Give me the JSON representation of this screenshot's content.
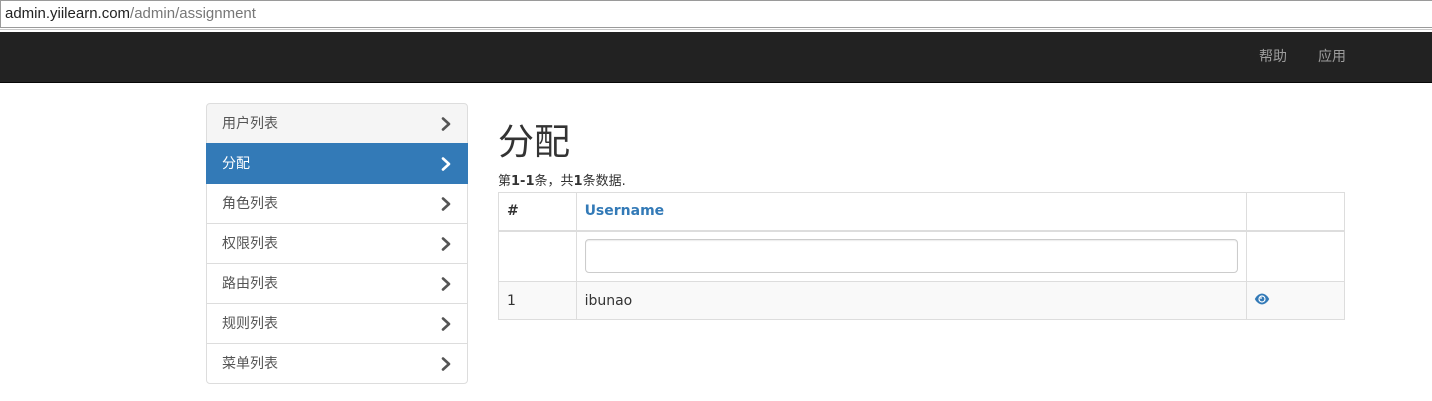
{
  "address_bar": {
    "host": "admin.yiilearn.com",
    "path": "/admin/assignment"
  },
  "navbar": {
    "items": [
      {
        "label": "帮助"
      },
      {
        "label": "应用"
      }
    ]
  },
  "sidebar": {
    "items": [
      {
        "label": "用户列表",
        "active": false
      },
      {
        "label": "分配",
        "active": true
      },
      {
        "label": "角色列表",
        "active": false
      },
      {
        "label": "权限列表",
        "active": false
      },
      {
        "label": "路由列表",
        "active": false
      },
      {
        "label": "规则列表",
        "active": false
      },
      {
        "label": "菜单列表",
        "active": false
      }
    ],
    "item_icon": "chevron-right-icon"
  },
  "main": {
    "title": "分配",
    "summary": {
      "prefix": "第",
      "range": "1-1",
      "middle": "条，共",
      "total": "1",
      "suffix": "条数据."
    },
    "table": {
      "headers": {
        "num": "#",
        "username": "Username",
        "actions": ""
      },
      "filter": {
        "username_value": "",
        "username_placeholder": ""
      },
      "rows": [
        {
          "num": "1",
          "username": "ibunao",
          "action_icon": "eye-icon"
        }
      ]
    }
  },
  "colors": {
    "navbar_bg": "#222222",
    "navbar_text": "#9d9d9d",
    "active_item_bg": "#337ab7",
    "link": "#337ab7"
  }
}
